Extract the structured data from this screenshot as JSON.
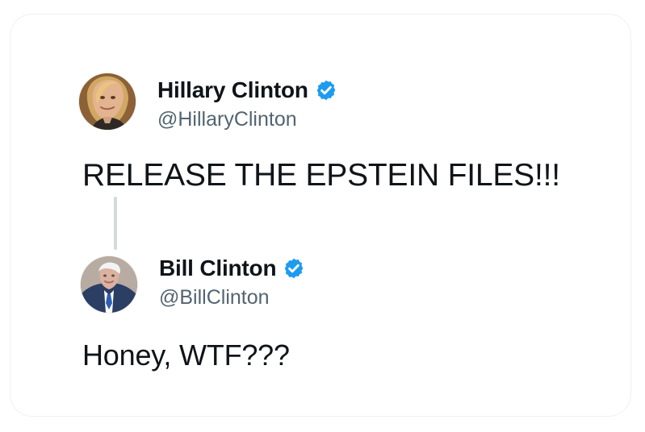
{
  "tweets": [
    {
      "author": {
        "display_name": "Hillary Clinton",
        "handle": "@HillaryClinton",
        "avatar_icon": "hillary-clinton-avatar",
        "verified_icon": "verified-badge-icon"
      },
      "text": "RELEASE THE EPSTEIN FILES!!!"
    },
    {
      "author": {
        "display_name": "Bill Clinton",
        "handle": "@BillClinton",
        "avatar_icon": "bill-clinton-avatar",
        "verified_icon": "verified-badge-icon"
      },
      "text": "Honey, WTF???"
    }
  ],
  "colors": {
    "verified_blue": "#1d9bf0",
    "text_primary": "#0f1419",
    "text_secondary": "#536471",
    "thread_line": "#d5d9dd",
    "card_border": "#eef0f2"
  }
}
